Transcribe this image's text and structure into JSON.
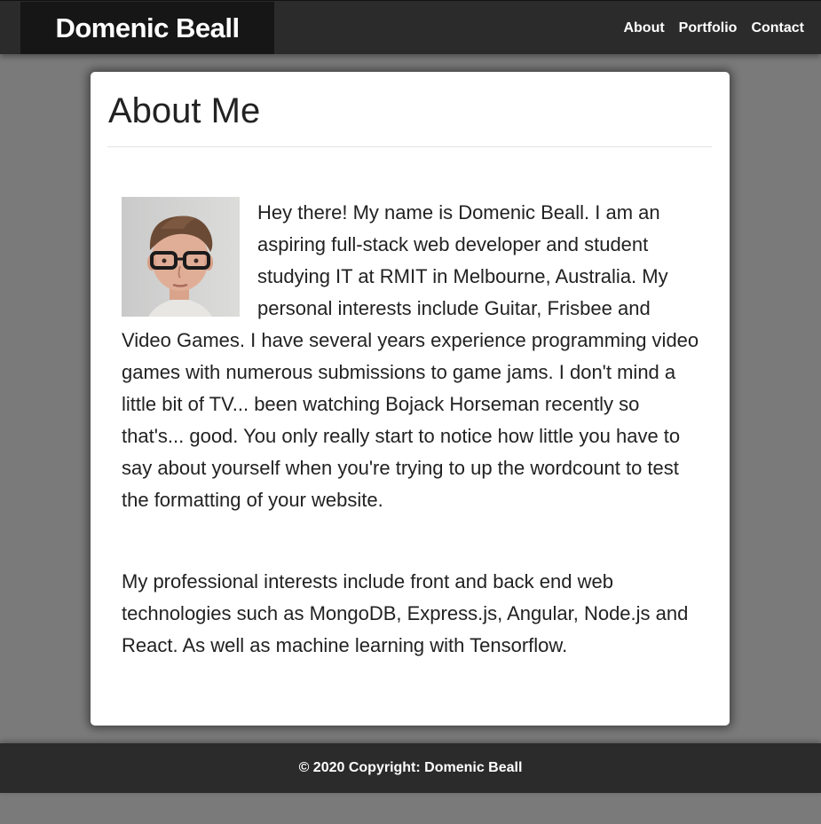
{
  "navbar": {
    "brand": "Domenic Beall",
    "links": [
      "About",
      "Portfolio",
      "Contact"
    ]
  },
  "card": {
    "title": "About Me",
    "paragraph1": "Hey there! My name is Domenic Beall. I am an aspiring full-stack web developer and student studying IT at RMIT in Melbourne, Australia. My personal interests include Guitar, Frisbee and Video Games. I have several years experience programming video games with numerous submissions to game jams. I don't mind a little bit of TV... been watching Bojack Horseman recently so that's... good. You only really start to notice how little you have to say about yourself when you're trying to up the wordcount to test the formatting of your website.",
    "paragraph2": "My professional interests include front and back end web technologies such as MongoDB, Express.js, Angular, Node.js and React. As well as machine learning with Tensorflow."
  },
  "footer": {
    "copyright": "© 2020 Copyright: Domenic Beall"
  },
  "colors": {
    "navbar_bg": "#2b2b2b",
    "brand_bg": "#161616",
    "page_bg": "#7a7a7a",
    "card_bg": "#ffffff",
    "text": "#222222"
  }
}
